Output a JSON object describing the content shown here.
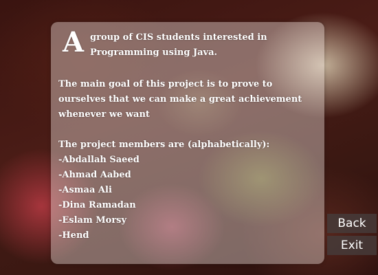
{
  "about": {
    "dropcap": "A",
    "intro_line1": "group of CIS students interested in",
    "intro_line2": "Programming using Java.",
    "goal": "The main goal of this project is to prove to ourselves that we can make a great achievement whenever we want",
    "members_heading": "The project members are (alphabetically):",
    "members": [
      "-Abdallah Saeed",
      "-Ahmad Aabed",
      "-Asmaa Ali",
      "-Dina Ramadan",
      "-Eslam Morsy",
      "-Hend"
    ]
  },
  "buttons": {
    "back": "Back",
    "exit": "Exit"
  }
}
